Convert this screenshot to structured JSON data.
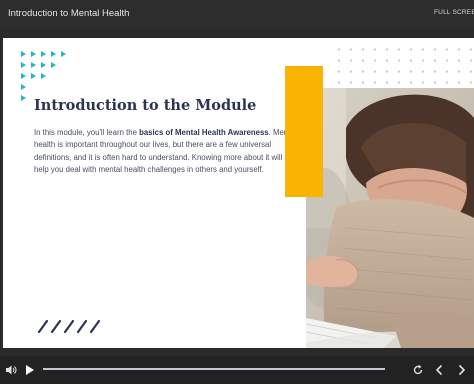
{
  "header": {
    "course_title": "Introduction to Mental Health",
    "fullscreen_label": "FULL SCREEN"
  },
  "slide": {
    "heading": "Introduction to the Module",
    "intro_text": "In this module, you'll learn the ",
    "intro_bold": "basics of Mental Health Awareness",
    "intro_rest": ". Mental health is important throughout our lives, but there are a few universal definitions, and it is often hard to understand. Knowing more about it will help you deal with mental health challenges in others and yourself.",
    "photo_alt": "woman with head resting on her arms, hand on her shoulder"
  },
  "player": {
    "progress_fraction": 1.0,
    "icons": [
      "volume-icon",
      "play-icon",
      "replay-icon",
      "previous-icon",
      "next-icon"
    ]
  },
  "colors": {
    "accent_teal": "#23b8c6",
    "accent_yellow": "#f9b300",
    "heading_navy": "#2b3553"
  }
}
